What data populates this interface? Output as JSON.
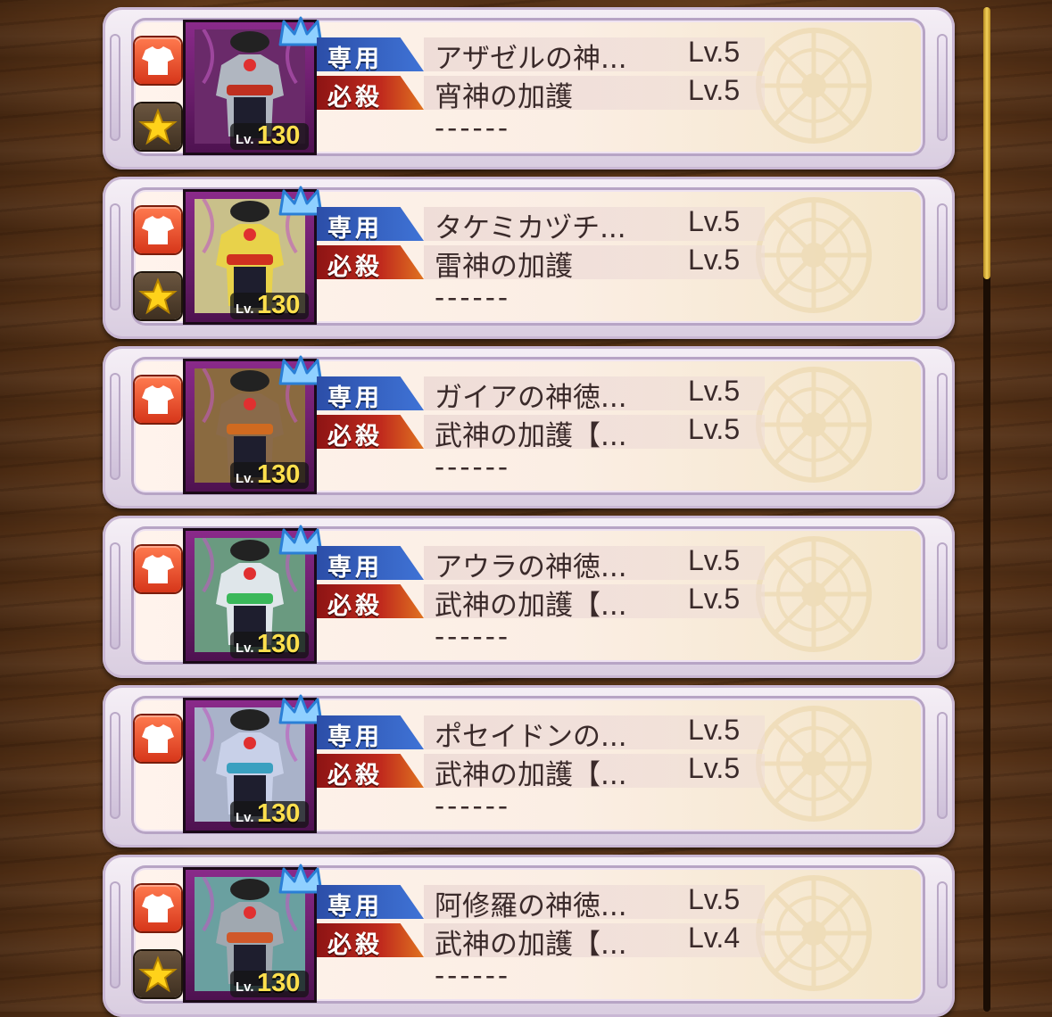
{
  "scrollbar": {
    "position_fraction": 0.0
  },
  "equipment_list": [
    {
      "level_label": "Lv.",
      "level": "130",
      "body_color": "#b0b6c0",
      "belt_color": "#c03020",
      "portrait_bg": "#6a2a6a",
      "favorite": true,
      "exclusive_tag": "専用",
      "exclusive_name": "アザゼルの神...",
      "exclusive_lv": "Lv.5",
      "special_tag": "必殺",
      "special_name": "宵神の加護",
      "special_lv": "Lv.5",
      "third_line": "------"
    },
    {
      "level_label": "Lv.",
      "level": "130",
      "body_color": "#e8d24a",
      "belt_color": "#d03020",
      "portrait_bg": "#c9c08a",
      "favorite": true,
      "exclusive_tag": "専用",
      "exclusive_name": "タケミカヅチ...",
      "exclusive_lv": "Lv.5",
      "special_tag": "必殺",
      "special_name": "雷神の加護",
      "special_lv": "Lv.5",
      "third_line": "------"
    },
    {
      "level_label": "Lv.",
      "level": "130",
      "body_color": "#8a6a4a",
      "belt_color": "#d06a20",
      "portrait_bg": "#8a6a40",
      "favorite": false,
      "exclusive_tag": "専用",
      "exclusive_name": "ガイアの神徳...",
      "exclusive_lv": "Lv.5",
      "special_tag": "必殺",
      "special_name": "武神の加護【...",
      "special_lv": "Lv.5",
      "third_line": "------"
    },
    {
      "level_label": "Lv.",
      "level": "130",
      "body_color": "#dfe6ea",
      "belt_color": "#3ab85a",
      "portrait_bg": "#6a9a80",
      "favorite": false,
      "exclusive_tag": "専用",
      "exclusive_name": "アウラの神徳...",
      "exclusive_lv": "Lv.5",
      "special_tag": "必殺",
      "special_name": "武神の加護【...",
      "special_lv": "Lv.5",
      "third_line": "------"
    },
    {
      "level_label": "Lv.",
      "level": "130",
      "body_color": "#c8d0e8",
      "belt_color": "#3aa0c0",
      "portrait_bg": "#a9b2c9",
      "favorite": false,
      "exclusive_tag": "専用",
      "exclusive_name": "ポセイドンの...",
      "exclusive_lv": "Lv.5",
      "special_tag": "必殺",
      "special_name": "武神の加護【...",
      "special_lv": "Lv.5",
      "third_line": "------"
    },
    {
      "level_label": "Lv.",
      "level": "130",
      "body_color": "#a0a8b0",
      "belt_color": "#d0582a",
      "portrait_bg": "#6aa0a0",
      "favorite": true,
      "exclusive_tag": "専用",
      "exclusive_name": "阿修羅の神徳...",
      "exclusive_lv": "Lv.5",
      "special_tag": "必殺",
      "special_name": "武神の加護【...",
      "special_lv": "Lv.4",
      "third_line": "------"
    }
  ]
}
